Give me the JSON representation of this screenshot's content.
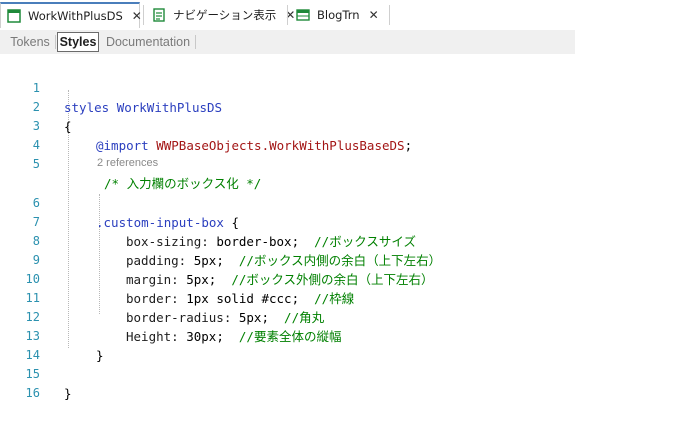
{
  "doc_tabs": [
    {
      "label": "WorkWithPlusDS",
      "icon": "object-icon",
      "active": true
    },
    {
      "label": "ナビゲーション表示",
      "icon": "web-panel-icon",
      "active": false
    },
    {
      "label": "BlogTrn",
      "icon": "transaction-icon",
      "active": false
    }
  ],
  "close_glyph": "✕",
  "sub_tabs": [
    {
      "label": "Tokens",
      "active": false
    },
    {
      "label": "Styles",
      "active": true
    },
    {
      "label": "Documentation",
      "active": false
    }
  ],
  "editor": {
    "line_numbers": [
      "1",
      "2",
      "3",
      "4",
      "5",
      "6",
      "7",
      "8",
      "9",
      "10",
      "11",
      "12",
      "13",
      "14",
      "15",
      "16"
    ],
    "line1": {
      "kw": "styles",
      "name": "WorkWithPlusDS"
    },
    "line2": {
      "brace": "{"
    },
    "line3": {
      "kw": "@import",
      "value": "WWPBaseObjects.WorkWithPlusBaseDS",
      "end": ";"
    },
    "line5": {
      "comment": "/* 入力欄のボックス化 */"
    },
    "codelens": "2 references",
    "line6": {
      "selector": ".custom-input-box",
      "brace": "{"
    },
    "line7": {
      "prop": "box-sizing:",
      "value": " border-box;",
      "comment": "  //ボックスサイズ"
    },
    "line8": {
      "prop": "padding:",
      "value": " 5px;",
      "comment": "  //ボックス内側の余白（上下左右）"
    },
    "line9": {
      "prop": "margin:",
      "value": " 5px;",
      "comment": "  //ボックス外側の余白（上下左右）"
    },
    "line10": {
      "prop": "border:",
      "value": " 1px solid #ccc;",
      "comment": "  //枠線"
    },
    "line11": {
      "prop": "border-radius:",
      "value": " 5px;",
      "comment": "  //角丸"
    },
    "line12": {
      "prop": "Height:",
      "value": " 30px;",
      "comment": "  //要素全体の縦幅"
    },
    "line13": {
      "brace": "}"
    },
    "line15": {
      "brace": "}"
    }
  },
  "colors": {
    "accent": "#4a7ebb",
    "line_number": "#2b91af",
    "keyword": "#2b3fbf",
    "comment": "#008000",
    "string": "#a31515"
  }
}
